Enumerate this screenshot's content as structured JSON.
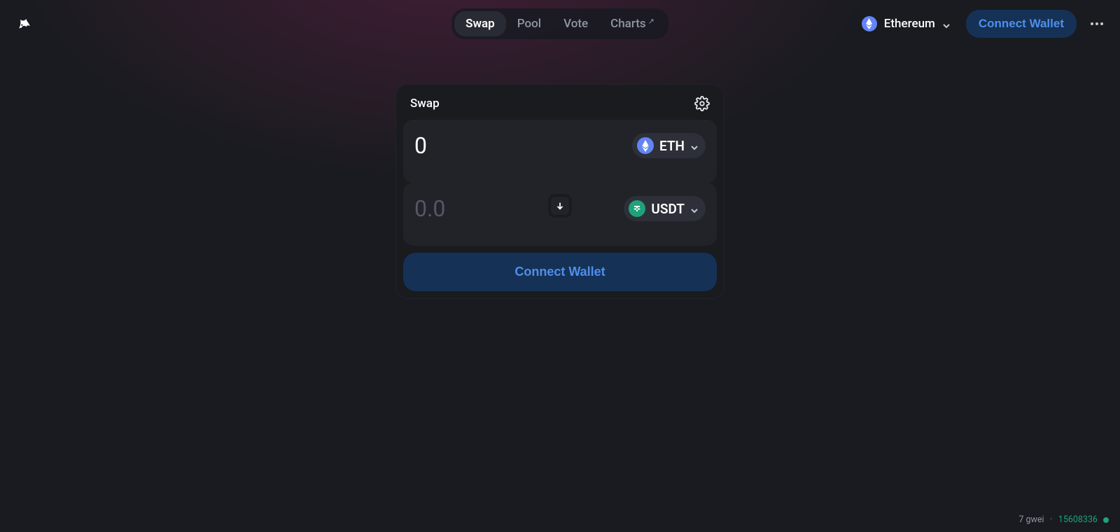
{
  "nav": {
    "swap": "Swap",
    "pool": "Pool",
    "vote": "Vote",
    "charts": "Charts"
  },
  "header": {
    "network": "Ethereum",
    "connect": "Connect Wallet"
  },
  "swap": {
    "title": "Swap",
    "from_value": "0",
    "from_token": "ETH",
    "to_placeholder": "0.0",
    "to_token": "USDT",
    "connect_cta": "Connect Wallet"
  },
  "footer": {
    "gwei": "7 gwei",
    "block": "15608336"
  }
}
